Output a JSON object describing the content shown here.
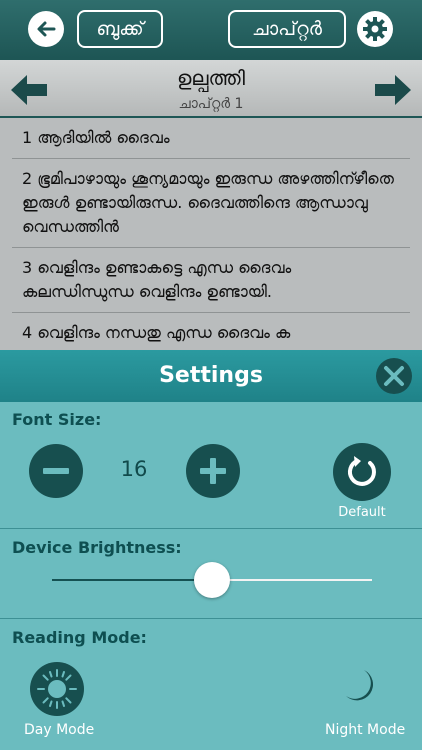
{
  "toolbar": {
    "book_label": "ബുക്ക്",
    "chapter_label": "ചാപ്റ്റർ"
  },
  "header": {
    "book_title": "ഉല്പത്തി",
    "chapter_label": "ചാപ്റ്റർ 1"
  },
  "verses": [
    "1 ആദിയിൽ ദൈവം",
    "2 ഭൂമിപാഴായും ശൂന്യമായും ഇരുന്ധ അഴത്തിന്ഴീതെ ഇരുൾ ഉണ്ടായിരുന്ധ. ദൈവത്തിന്ദെ ആന്ധാവു വെന്ധത്തിൻ",
    "3 വെളിന്ദം ഉണ്ടാകട്ടെ എന്ധ ദൈവം കലന്ധിന്ധുന്ധ വെളിന്ദം ഉണ്ടായി.",
    "4 വെളിന്ദം നന്ധതു എന്ധ ദൈവം ക"
  ],
  "settings": {
    "title": "Settings",
    "font_size_label": "Font Size:",
    "font_size_value": "16",
    "default_label": "Default",
    "brightness_label": "Device Brightness:",
    "brightness": 0.5,
    "reading_mode_label": "Reading Mode:",
    "day_mode_label": "Day Mode",
    "night_mode_label": "Night Mode"
  },
  "icons": {
    "back": "back-arrow-icon",
    "settings": "gear-icon",
    "prev": "left-arrow-icon",
    "next": "right-arrow-icon",
    "close": "close-icon",
    "minus": "minus-icon",
    "plus": "plus-icon",
    "reset": "reset-icon",
    "day": "sun-icon",
    "night": "moon-icon"
  },
  "colors": {
    "toolbar": "#2f6e6d",
    "panel": "#6bbcbf",
    "panel_header": "#2b9aa0",
    "button": "#174f4f"
  }
}
